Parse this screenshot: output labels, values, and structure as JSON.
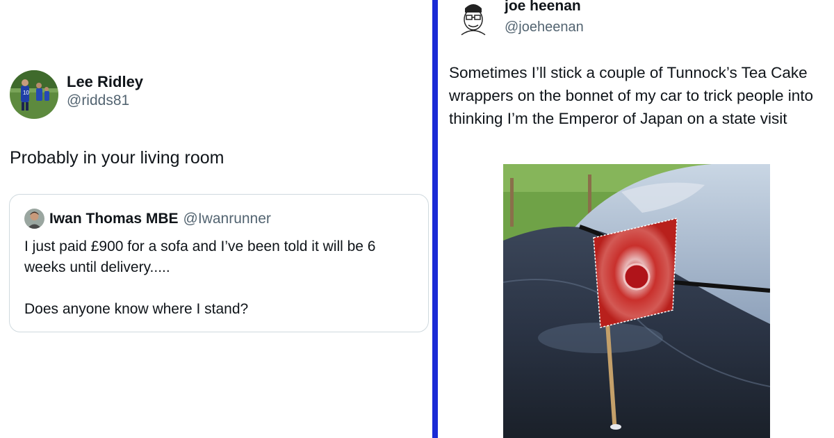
{
  "left_tweet": {
    "author": {
      "name": "Lee Ridley",
      "handle": "@ridds81",
      "avatar": "footballer-avatar"
    },
    "text": "Probably in your living room",
    "quoted_tweet": {
      "author": {
        "name": "Iwan Thomas MBE",
        "handle": "@Iwanrunner",
        "avatar": "person-avatar"
      },
      "text_line1": "I just paid £900 for a sofa and I’ve been told it will be 6 weeks until delivery.....",
      "text_line2": "Does anyone know where I stand?"
    }
  },
  "right_tweet": {
    "author": {
      "name": "joe heenan",
      "handle": "@joeheenan",
      "avatar": "cartoon-sketch-avatar"
    },
    "text": "Sometimes I’ll stick a couple of Tunnock’s Tea Cake wrappers on the bonnet of my car to trick people into thinking I’m the Emperor of Japan on a state visit",
    "image": "car-bonnet-photo-with-wrapper-flag"
  },
  "colors": {
    "divider": "#1a2bd6",
    "text_primary": "#0f1419",
    "text_secondary": "#536471",
    "card_border": "#cfd9de"
  }
}
